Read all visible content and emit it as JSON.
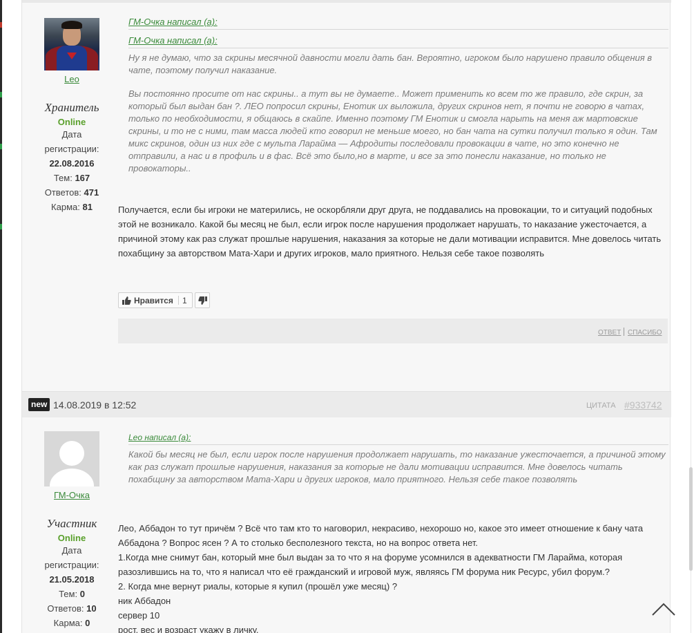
{
  "posts": [
    {
      "author": {
        "name": "Leo",
        "role": "Хранитель",
        "status": "Online",
        "reg_label_1": "Дата",
        "reg_label_2": "регистрации:",
        "reg_date": "22.08.2016",
        "topics_label": "Тем:",
        "topics": "167",
        "replies_label": "Ответов:",
        "replies": "471",
        "karma_label": "Карма:",
        "karma": "81"
      },
      "quote_head_1": "ГМ-Очка написал (а):",
      "quote_head_2": "ГМ-Очка написал (а):",
      "quote_inner": "Ну я не думаю, что за скрины месячной давности могли дать бан. Вероятно, игроком было нарушено правило общения в чате, поэтому получил наказание.",
      "quote_outer": "Вы постоянно просите от нас скрины.. а тут вы не думаете.. Может применить ко всем то же правило, где скрин, за который был выдан бан ?. ЛЕО попросил скрины, Енотик их выложила, других скринов нет, я почти не говорю в чатах, только по необходимости, я общаюсь в скайпе. Именно поэтому ГМ Енотик и смогла нарыть на меня аж мартовские скрины, и то не с ними, там масса людей кто говорил не меньше моего, но бан чата на сутки получил только я один. Там микс скринов, один из них где с мульта Ларайма — Афродиты последовали провокации в чате, но это конечно не отправили, а нас и в профиль и в фас. Всё это было,но в марте, и все за это понесли наказание, но только не провокаторы..",
      "body": "Получается, если бы игроки не матерились, не оскорбляли друг друга, не поддавались на провокации, то и ситуаций подобных этой не возникало. Какой бы месяц не был, если игрок после нарушения продолжает нарушать, то наказание ужесточается, а причиной этому как раз служат прошлые нарушения, наказания за которые не дали мотивации исправится. Мне довелось читать похабщину за авторством Мата-Хари и других игроков, мало приятного. Нельзя себе такое позволять",
      "like_label": "Нравится",
      "like_count": "1",
      "reply_label": "ответ",
      "thanks_label": "спасибо"
    },
    {
      "badge": "new",
      "date": "14.08.2019 в 12:52",
      "quote_label": "ЦИТАТА",
      "post_number": "#933742",
      "author": {
        "name": "ГМ-Очка",
        "role": "Участник",
        "status": "Online",
        "reg_label_1": "Дата",
        "reg_label_2": "регистрации:",
        "reg_date": "21.05.2018",
        "topics_label": "Тем:",
        "topics": "0",
        "replies_label": "Ответов:",
        "replies": "10",
        "karma_label": "Карма:",
        "karma": "0"
      },
      "quote_head": "Leo написал (а):",
      "quote": "Какой бы месяц не был, если игрок после нарушения продолжает нарушать, то наказание ужесточается, а причиной этому как раз служат прошлые нарушения, наказания за которые не дали мотивации исправится. Мне довелось читать похабщину за авторством Мата-Хари и других игроков, мало приятного. Нельзя себе такое позволять",
      "body_lines": [
        "Лео, Аббадон то тут причём ? Всё что там кто то наговорил, некрасиво, нехорошо но, какое это имеет отношение к бану чата Аббадона ? Вопрос ясен ? А то столько бесполезного текста, но на вопрос ответа нет.",
        "1.Когда мне снимут бан, который мне был выдан за то что я на форуме усомнился в адекватности ГМ Ларайма, которая разозлившись на то, что я написал что её гражданский и игровой муж, являясь ГМ форума ник Ресурс, убил форум.?",
        "2. Когда мне вернут риалы, которые я купил (прошёл уже месяц) ?",
        "ник Аббадон",
        "сервер 10",
        "рост, вес и возраст укажу в личку."
      ]
    }
  ],
  "colors": {
    "link_green": "#3a8a3a",
    "online_green": "#5aa02c",
    "quote_gray": "#7a7a7a"
  },
  "icons": [
    "thumbs-up-icon",
    "thumbs-down-icon",
    "scroll-top-chevron-icon",
    "user-placeholder-icon"
  ]
}
